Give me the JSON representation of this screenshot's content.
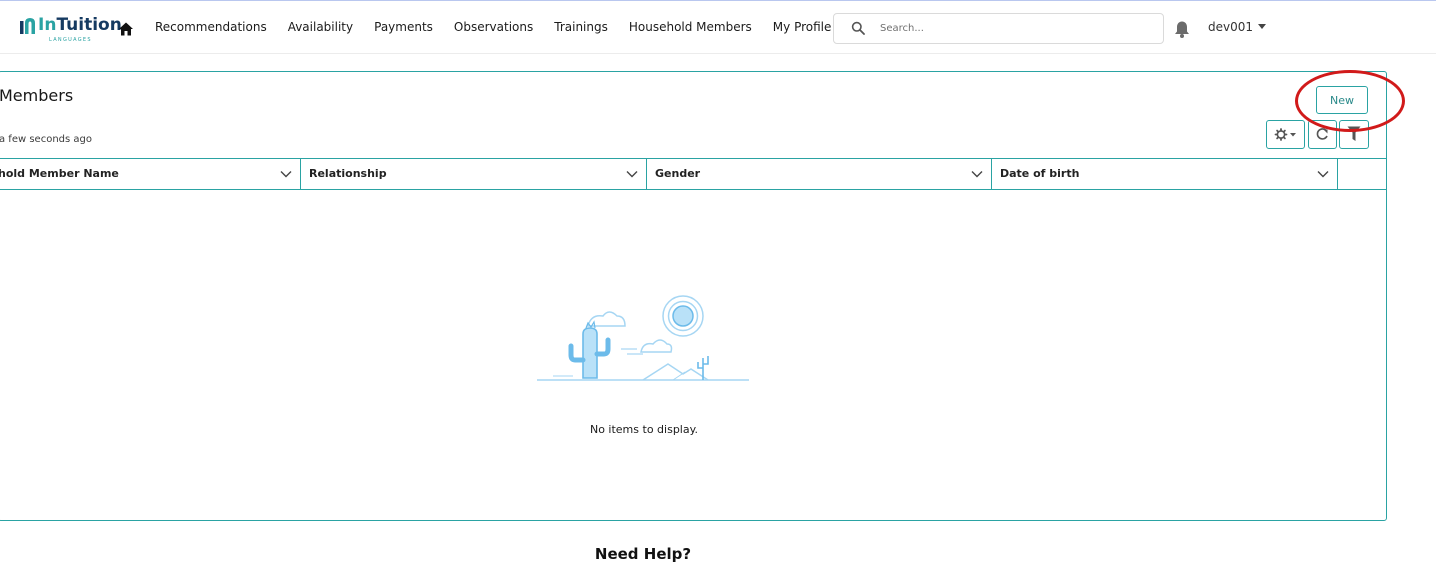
{
  "brand": {
    "name_prefix": "In",
    "name_suffix": "Tuition",
    "tagline": "LANGUAGES",
    "primary_color": "#153a61",
    "accent_color": "#2aa3a3"
  },
  "nav": {
    "home_icon": "home-icon",
    "items": [
      {
        "label": "Recommendations"
      },
      {
        "label": "Availability"
      },
      {
        "label": "Payments"
      },
      {
        "label": "Observations"
      },
      {
        "label": "Trainings"
      },
      {
        "label": "Household Members"
      },
      {
        "label": "My Profile"
      }
    ]
  },
  "search": {
    "placeholder": "Search...",
    "icon": "search-icon"
  },
  "user": {
    "name": "dev001",
    "notification_icon": "bell-icon"
  },
  "list": {
    "title": "Members",
    "updated": "a few seconds ago",
    "new_label": "New",
    "columns": [
      {
        "label": "hold Member Name"
      },
      {
        "label": "Relationship"
      },
      {
        "label": "Gender"
      },
      {
        "label": "Date of birth"
      }
    ],
    "empty_message": "No items to display.",
    "annotation_color": "#d11a1a"
  },
  "footer": {
    "help_title": "Need Help?"
  }
}
